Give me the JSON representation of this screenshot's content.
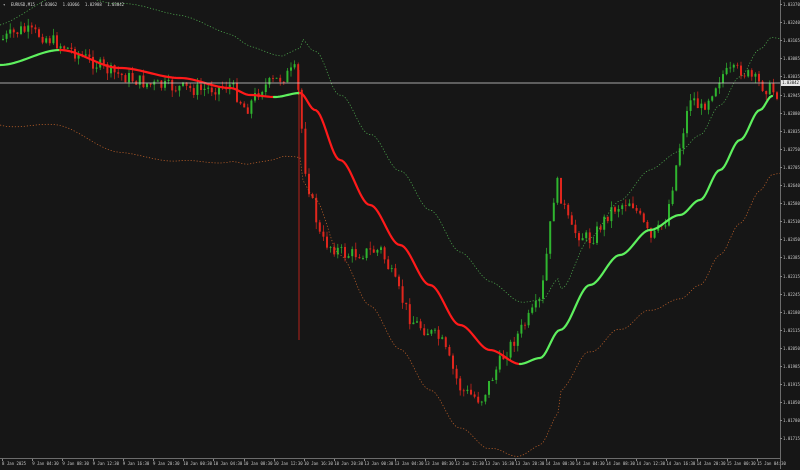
{
  "window": {
    "symbol_menu_icon": "dropdown-triangle-icon",
    "symbol": "EURUSD,M15",
    "ohlc": [
      "1.03062",
      "1.03066",
      "1.02988",
      "1.03042"
    ]
  },
  "colors": {
    "background": "#161616",
    "bull_candle": "#2fb52f",
    "bear_candle": "#e0261d",
    "midline_up": "#5ef05e",
    "midline_down": "#ff1a1a",
    "upper_band": "#52b552",
    "lower_band": "#c9652a",
    "price_line": "#d6d6d6"
  },
  "price_axis": {
    "labels": [
      "1.03370",
      "1.03240",
      "1.03165",
      "1.03085",
      "1.03035",
      "1.02945",
      "1.02880",
      "1.02835",
      "1.02750",
      "1.02705",
      "1.02640",
      "1.02580",
      "1.02510",
      "1.02450",
      "1.02385",
      "1.02315",
      "1.02245",
      "1.02180",
      "1.02115",
      "1.02050",
      "1.01985",
      "1.01915",
      "1.01850",
      "1.01780",
      "1.01715"
    ],
    "current_price": "1.03042"
  },
  "time_axis": {
    "labels": [
      "8 Jan 2025",
      "9 Jan 04:30",
      "9 Jan 08:30",
      "9 Jan 12:30",
      "9 Jan 16:30",
      "9 Jan 20:30",
      "10 Jan 00:30",
      "10 Jan 04:30",
      "10 Jan 08:30",
      "10 Jan 12:30",
      "10 Jan 16:30",
      "10 Jan 20:30",
      "13 Jan 00:30",
      "13 Jan 04:30",
      "13 Jan 08:30",
      "13 Jan 12:30",
      "13 Jan 16:30",
      "13 Jan 20:30",
      "14 Jan 00:30",
      "14 Jan 04:30",
      "14 Jan 08:30",
      "14 Jan 12:30",
      "14 Jan 16:30",
      "14 Jan 20:30",
      "15 Jan 00:30",
      "15 Jan 04:30"
    ]
  },
  "chart_data": {
    "type": "candlestick",
    "symbol": "EURUSD,M15",
    "ylim": [
      1.0168,
      1.0342
    ],
    "current_price": 1.03042,
    "bands": "dotted upper and lower envelope around a colored midline (green rising, red falling)"
  }
}
